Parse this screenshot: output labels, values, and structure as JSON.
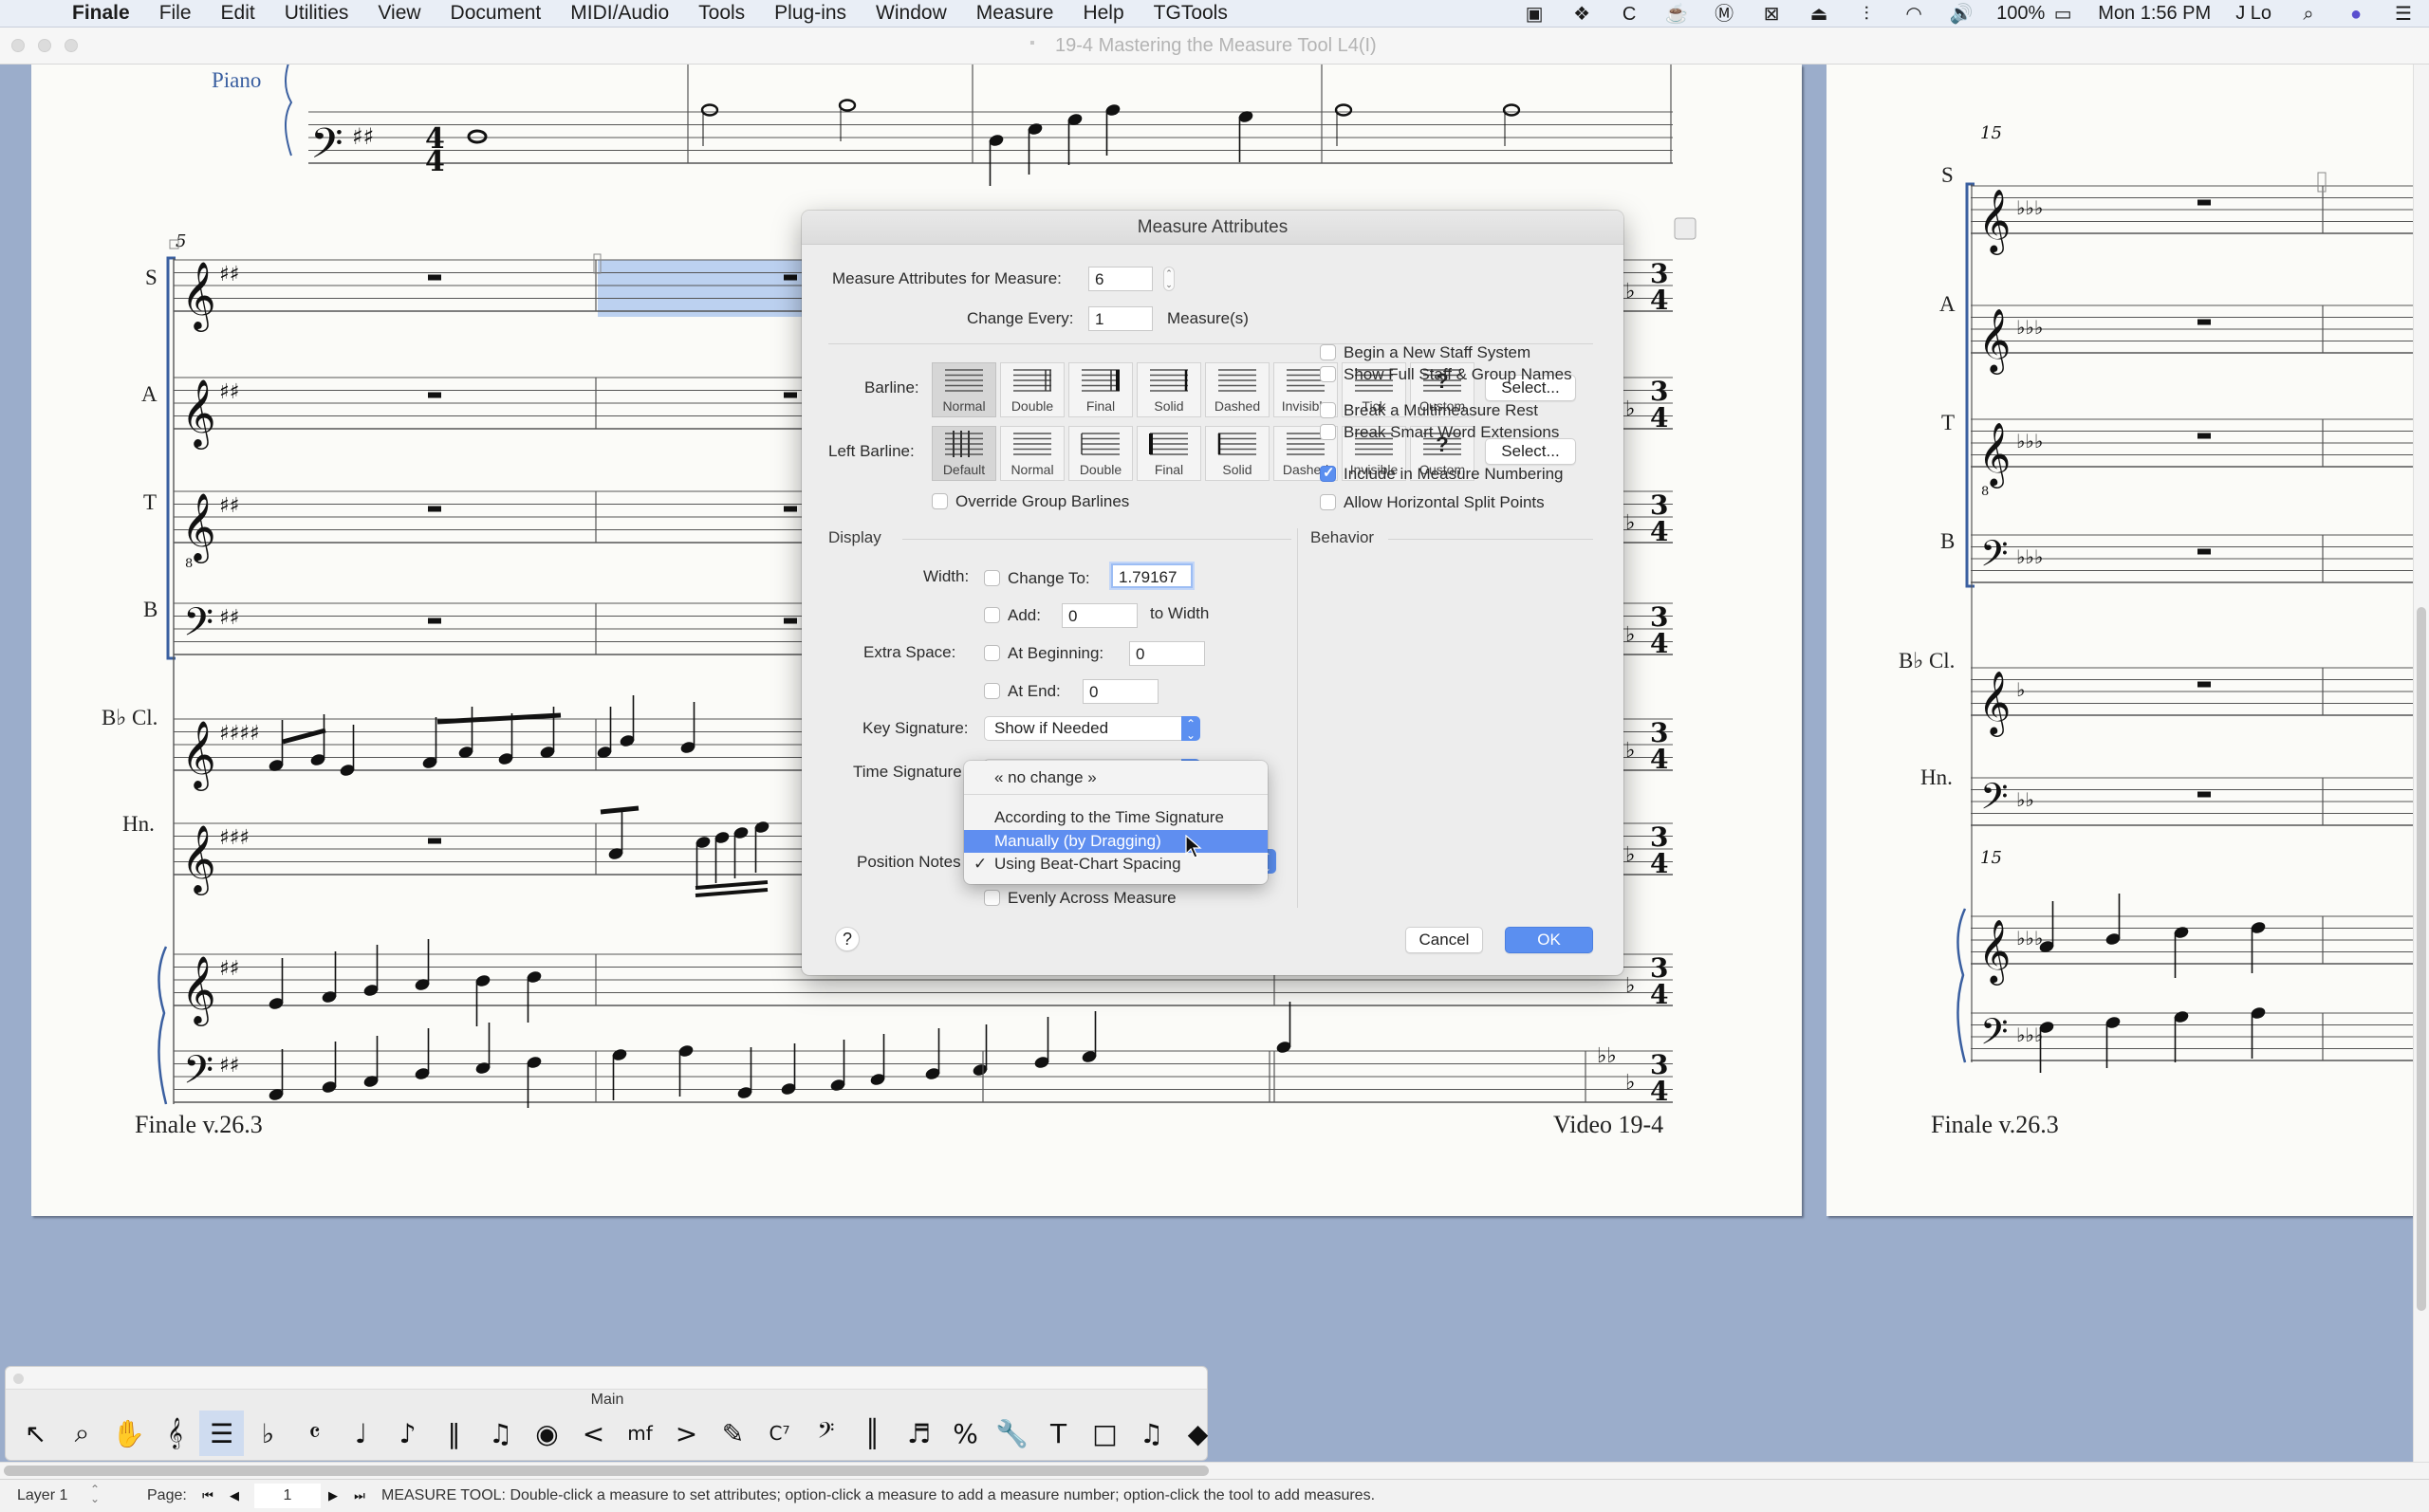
{
  "menubar": {
    "app": "Finale",
    "items": [
      "File",
      "Edit",
      "Utilities",
      "View",
      "Document",
      "MIDI/Audio",
      "Tools",
      "Plug-ins",
      "Window",
      "Measure",
      "Help",
      "TGTools"
    ],
    "status_icons": [
      "display-icon",
      "dropbox-icon",
      "c-app-icon",
      "coffee-icon",
      "m-app-icon",
      "x-app-icon",
      "airplay-icon",
      "audio-wave-icon",
      "wifi-icon",
      "volume-icon"
    ],
    "battery": "100%",
    "clock": "Mon 1:56 PM",
    "user": "J Lo"
  },
  "window": {
    "title": "19-4 Mastering the Measure Tool L4(I)"
  },
  "score": {
    "page1": {
      "top_staff_label": "Piano",
      "staff_labels": [
        "S",
        "A",
        "T",
        "B",
        "B♭ Cl.",
        "Hn."
      ],
      "measure_number": "5",
      "time_signature_top": "4",
      "time_signature_bottom": "4",
      "end_time_sig_top": "3",
      "end_time_sig_bottom": "4",
      "footer_left": "Finale v.26.3",
      "footer_right": "Video 19-4"
    },
    "page2": {
      "staff_labels": [
        "S",
        "A",
        "T",
        "B",
        "B♭ Cl.",
        "Hn."
      ],
      "measure_number": "15",
      "footer_left": "Finale v.26.3"
    }
  },
  "dialog": {
    "title": "Measure Attributes",
    "measure_label": "Measure Attributes for Measure:",
    "measure_value": "6",
    "change_every_label": "Change Every:",
    "change_every_value": "1",
    "change_every_unit": "Measure(s)",
    "barline_label": "Barline:",
    "barline_options": [
      "Normal",
      "Double",
      "Final",
      "Solid",
      "Dashed",
      "Invisible",
      "Tick",
      "Custom"
    ],
    "barline_selected": "Normal",
    "left_barline_label": "Left Barline:",
    "left_barline_options": [
      "Default",
      "Normal",
      "Double",
      "Final",
      "Solid",
      "Dashed",
      "Invisible",
      "Custom"
    ],
    "left_barline_selected": "Default",
    "select_button": "Select...",
    "override_group_barlines": {
      "label": "Override Group Barlines",
      "checked": false
    },
    "display": {
      "title": "Display",
      "width_label": "Width:",
      "change_to_label": "Change To:",
      "change_to_value": "1.79167",
      "change_to_checked": false,
      "add_label": "Add:",
      "add_value": "0",
      "add_checked": false,
      "to_width": "to Width",
      "extra_space_label": "Extra Space:",
      "at_beginning_label": "At Beginning:",
      "at_beginning_value": "0",
      "at_end_label": "At End:",
      "at_end_value": "0",
      "key_signature_label": "Key Signature:",
      "key_signature_value": "Show if Needed",
      "time_signature_label": "Time Signature",
      "position_notes_label": "Position Notes",
      "evenly_label": "Evenly Across Measure",
      "evenly_checked": false
    },
    "behavior": {
      "title": "Behavior",
      "options": [
        {
          "label": "Begin a New Staff System",
          "checked": false
        },
        {
          "label": "Show Full Staff & Group Names",
          "checked": false
        },
        {
          "label": "Break a Multimeasure Rest",
          "checked": false
        },
        {
          "label": "Break Smart Word Extensions",
          "checked": false
        },
        {
          "label": "Include in Measure Numbering",
          "checked": true
        },
        {
          "label": "Allow Horizontal Split Points",
          "checked": false
        }
      ]
    },
    "help_button": "?",
    "cancel_button": "Cancel",
    "ok_button": "OK",
    "accent_color": "#5b8ff0"
  },
  "dropdown": {
    "items": [
      {
        "label": "« no change »",
        "checked": false,
        "highlighted": false
      },
      {
        "label": "According to the Time Signature",
        "checked": false,
        "highlighted": false
      },
      {
        "label": "Manually (by Dragging)",
        "checked": false,
        "highlighted": true
      },
      {
        "label": "Using Beat-Chart Spacing",
        "checked": true,
        "highlighted": false
      }
    ],
    "check_glyph": "✓"
  },
  "palette": {
    "title": "Main",
    "tools": [
      {
        "name": "selection-tool",
        "glyph": "↖"
      },
      {
        "name": "zoom-tool",
        "glyph": "⌕"
      },
      {
        "name": "hand-grabber-tool",
        "glyph": "✋"
      },
      {
        "name": "staff-tool",
        "glyph": "𝄞"
      },
      {
        "name": "measure-tool",
        "glyph": "☰",
        "selected": true
      },
      {
        "name": "key-signature-tool",
        "glyph": "♭"
      },
      {
        "name": "time-signature-tool",
        "glyph": "𝄴"
      },
      {
        "name": "simple-entry-tool",
        "glyph": "♩"
      },
      {
        "name": "speedy-entry-tool",
        "glyph": "♪"
      },
      {
        "name": "hyperscribe-tool",
        "glyph": "‖"
      },
      {
        "name": "tuplet-tool",
        "glyph": "♫"
      },
      {
        "name": "smart-shape-tool",
        "glyph": "◉"
      },
      {
        "name": "hairpin-tool",
        "glyph": "<"
      },
      {
        "name": "expression-tool",
        "glyph": "mf"
      },
      {
        "name": "articulation-tool",
        "glyph": ">"
      },
      {
        "name": "lyrics-tool",
        "glyph": "✎"
      },
      {
        "name": "chord-tool",
        "glyph": "C⁷"
      },
      {
        "name": "clef-tool",
        "glyph": "𝄢"
      },
      {
        "name": "repeat-tool",
        "glyph": "║"
      },
      {
        "name": "mirror-tool",
        "glyph": "♬"
      },
      {
        "name": "percent-tool",
        "glyph": "%"
      },
      {
        "name": "wrench-tool",
        "glyph": "🔧"
      },
      {
        "name": "text-tool",
        "glyph": "T"
      },
      {
        "name": "page-layout-tool",
        "glyph": "□"
      },
      {
        "name": "special-tools",
        "glyph": "♫"
      },
      {
        "name": "graphics-tool",
        "glyph": "◆"
      }
    ]
  },
  "statusbar": {
    "layer": "Layer 1",
    "page_label": "Page:",
    "page_value": "1",
    "message": "MEASURE TOOL: Double-click a measure to set attributes; option-click a measure to add a measure number; option-click the tool to add measures."
  }
}
